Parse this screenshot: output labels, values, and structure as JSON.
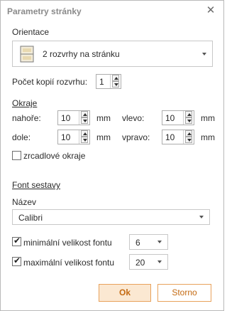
{
  "title": "Parametry stránky",
  "orientation": {
    "label": "Orientace",
    "selected": "2 rozvrhy na stránku"
  },
  "copies": {
    "label": "Počet kopií rozvrhu:",
    "value": "1"
  },
  "margins": {
    "label": "Okraje",
    "top_label": "nahoře:",
    "top_value": "10",
    "top_unit": "mm",
    "left_label": "vlevo:",
    "left_value": "10",
    "left_unit": "mm",
    "bottom_label": "dole:",
    "bottom_value": "10",
    "bottom_unit": "mm",
    "right_label": "vpravo:",
    "right_value": "10",
    "right_unit": "mm",
    "mirror_label": "zrcadlové okraje"
  },
  "font": {
    "section": "Font sestavy",
    "name_label": "Název",
    "name_value": "Calibri",
    "min_label": "minimální velikost fontu",
    "min_value": "6",
    "max_label": "maximální velikost fontu",
    "max_value": "20"
  },
  "buttons": {
    "ok": "Ok",
    "cancel": "Storno"
  },
  "colors": {
    "accent": "#c46a12",
    "ok_bg": "#fbe8d2",
    "border": "#e8a25c"
  }
}
